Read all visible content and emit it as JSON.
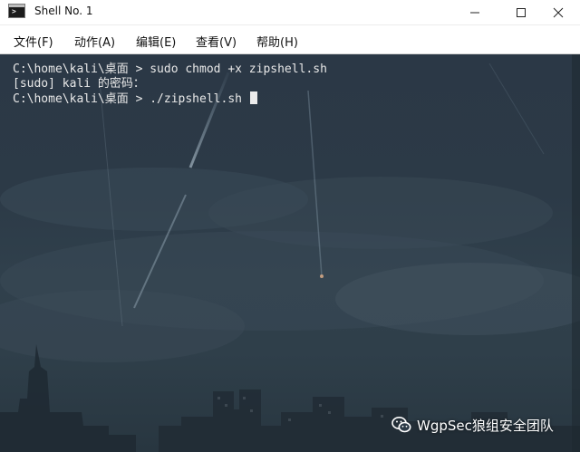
{
  "window": {
    "title": "Shell No. 1"
  },
  "menu": [
    {
      "label": "文件(F)"
    },
    {
      "label": "动作(A)"
    },
    {
      "label": "编辑(E)"
    },
    {
      "label": "查看(V)"
    },
    {
      "label": "帮助(H)"
    }
  ],
  "terminal": {
    "lines": [
      "C:\\home\\kali\\桌面 > sudo chmod +x zipshell.sh",
      "[sudo] kali 的密码：",
      "C:\\home\\kali\\桌面 > ./zipshell.sh "
    ]
  },
  "watermark": {
    "text": "WgpSec狼组安全团队",
    "icon": "wechat-icon"
  },
  "colors": {
    "terminal_bg": "#2c3a47",
    "terminal_fg": "#e8e8e8",
    "chrome_bg": "#ffffff"
  }
}
